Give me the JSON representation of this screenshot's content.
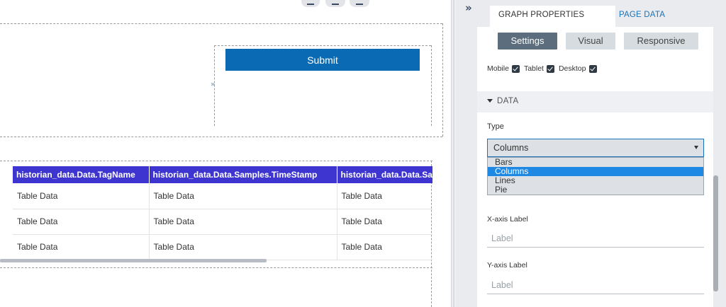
{
  "canvas": {
    "submit_label": "Submit",
    "expand_glyph": "»",
    "table": {
      "columns": [
        "historian_data.Data.TagName",
        "historian_data.Data.Samples.TimeStamp",
        "historian_data.Data.Samples.Value"
      ],
      "rows": [
        [
          "Table Data",
          "Table Data",
          "Table Data"
        ],
        [
          "Table Data",
          "Table Data",
          "Table Data"
        ],
        [
          "Table Data",
          "Table Data",
          "Table Data"
        ]
      ]
    }
  },
  "panel": {
    "collapse_glyph": "»",
    "tabs": [
      {
        "label": "GRAPH PROPERTIES",
        "active": true
      },
      {
        "label": "PAGE DATA",
        "active": false
      }
    ],
    "sub_tabs": [
      {
        "label": "Settings",
        "active": true
      },
      {
        "label": "Visual",
        "active": false
      },
      {
        "label": "Responsive",
        "active": false
      }
    ],
    "devices": [
      {
        "label": "Mobile",
        "checked": true
      },
      {
        "label": "Tablet",
        "checked": true
      },
      {
        "label": "Desktop",
        "checked": true
      }
    ],
    "data_section": {
      "title": "DATA",
      "type_label": "Type",
      "type_value": "Columns",
      "type_options": [
        "Bars",
        "Columns",
        "Lines",
        "Pie"
      ],
      "selected_option": "Columns",
      "x_axis_label_title": "X-axis Label",
      "x_axis_placeholder": "Label",
      "y_axis_label_title": "Y-axis Label",
      "y_axis_placeholder": "Label"
    }
  },
  "colors": {
    "submit_bg": "#0a6ab3",
    "table_header_bg": "#3e35d0",
    "active_subtab_bg": "#5c6e7d",
    "selected_option_bg": "#1e88e5",
    "page_tab_text": "#1a73b8"
  }
}
